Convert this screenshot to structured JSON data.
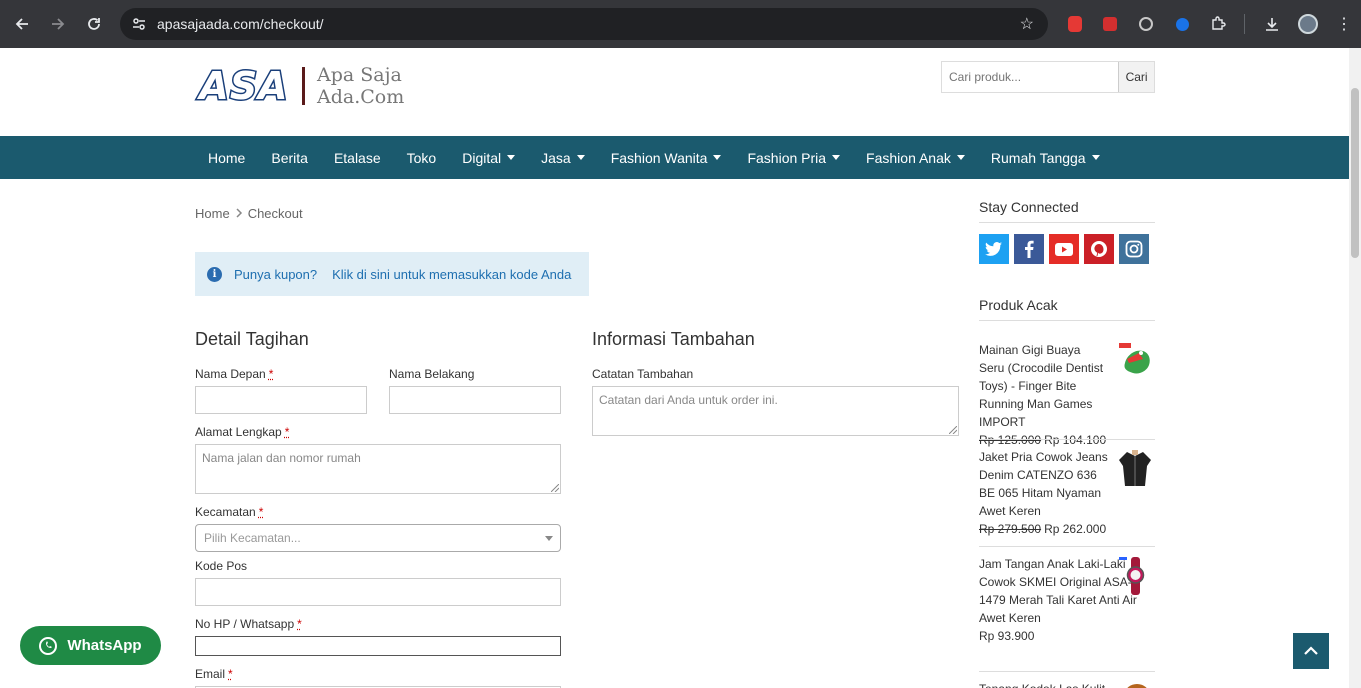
{
  "browser": {
    "url": "apasajaada.com/checkout/"
  },
  "header": {
    "logo_mark": "ASA",
    "logo_line1": "Apa Saja",
    "logo_line2": "Ada.Com",
    "search_placeholder": "Cari produk...",
    "search_button": "Cari"
  },
  "nav": {
    "items": [
      {
        "label": "Home",
        "dropdown": false
      },
      {
        "label": "Berita",
        "dropdown": false
      },
      {
        "label": "Etalase",
        "dropdown": false
      },
      {
        "label": "Toko",
        "dropdown": false
      },
      {
        "label": "Digital",
        "dropdown": true
      },
      {
        "label": "Jasa",
        "dropdown": true
      },
      {
        "label": "Fashion Wanita",
        "dropdown": true
      },
      {
        "label": "Fashion Pria",
        "dropdown": true
      },
      {
        "label": "Fashion Anak",
        "dropdown": true
      },
      {
        "label": "Rumah Tangga",
        "dropdown": true
      }
    ]
  },
  "breadcrumb": {
    "home": "Home",
    "separator": "›",
    "current": "Checkout"
  },
  "coupon": {
    "question": "Punya kupon?",
    "link": "Klik di sini untuk memasukkan kode Anda"
  },
  "billing": {
    "title": "Detail Tagihan",
    "first_name_label": "Nama Depan",
    "last_name_label": "Nama Belakang",
    "address_label": "Alamat Lengkap",
    "address_placeholder": "Nama jalan dan nomor rumah",
    "district_label": "Kecamatan",
    "district_placeholder": "Pilih Kecamatan...",
    "postcode_label": "Kode Pos",
    "phone_label": "No HP / Whatsapp",
    "email_label": "Email",
    "required_mark": "*"
  },
  "additional": {
    "title": "Informasi Tambahan",
    "notes_label": "Catatan Tambahan",
    "notes_placeholder": "Catatan dari Anda untuk order ini."
  },
  "sidebar": {
    "stay_connected": "Stay Connected",
    "social": [
      "twitter",
      "facebook",
      "youtube",
      "pinterest",
      "instagram"
    ],
    "random_products_title": "Produk Acak",
    "products": [
      {
        "name": "Mainan Gigi Buaya Seru (Crocodile Dentist Toys) - Finger Bite Running Man Games IMPORT",
        "old_price": "Rp 125.000",
        "price": "Rp 104.100"
      },
      {
        "name": "Jaket Pria Cowok Jeans Denim CATENZO 636 BE 065 Hitam Nyaman Awet Keren",
        "old_price": "Rp 279.500",
        "price": "Rp 262.000"
      },
      {
        "name": "Jam Tangan Anak Laki-Laki Cowok SKMEI Original ASA-1479 Merah Tali Karet Anti Air Awet Keren",
        "old_price": "",
        "price": "Rp 93.900"
      },
      {
        "name": "Tenang Kodok Las Kulit",
        "old_price": "",
        "price": ""
      }
    ]
  },
  "whatsapp": {
    "label": "WhatsApp"
  },
  "colors": {
    "nav_bg": "#1b5a6e",
    "whatsapp": "#1f8a45",
    "twitter": "#1da1f2",
    "facebook": "#3b5998",
    "youtube": "#e52d27",
    "pinterest": "#cb2027",
    "instagram": "#3f729b"
  }
}
